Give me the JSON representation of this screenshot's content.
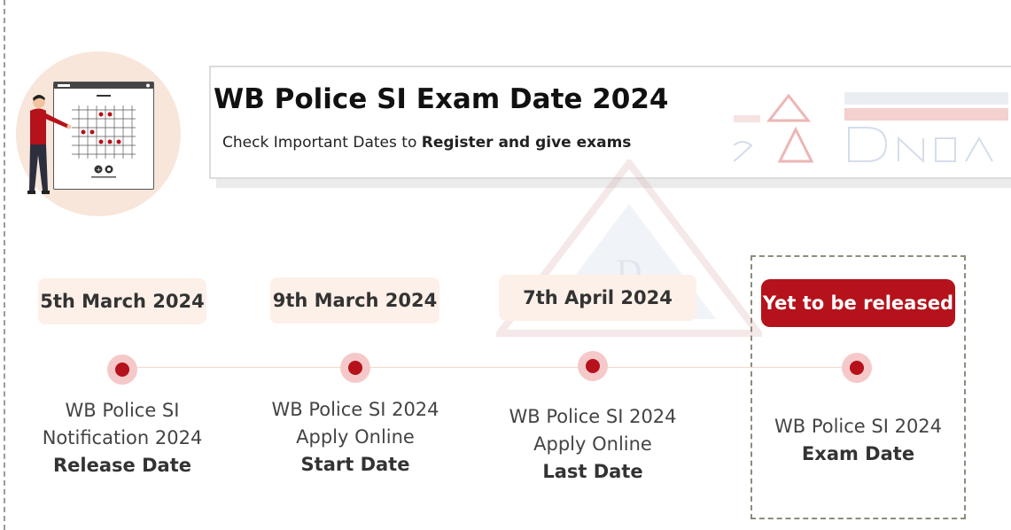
{
  "header": {
    "title": "WB Police SI Exam Date 2024",
    "subtitle_plain": "Check Important Dates to ",
    "subtitle_bold": "Register and give exams"
  },
  "timeline": [
    {
      "date": "5th March 2024",
      "lines": [
        "WB Police SI",
        "Notification 2024"
      ],
      "strong": "Release Date"
    },
    {
      "date": "9th March 2024",
      "lines": [
        "WB Police SI 2024",
        "Apply Online"
      ],
      "strong": "Start Date"
    },
    {
      "date": "7th April 2024",
      "lines": [
        "WB Police SI 2024",
        "Apply Online"
      ],
      "strong": "Last Date"
    },
    {
      "date": "Yet to be released",
      "lines": [
        "WB Police SI 2024"
      ],
      "strong": "Exam Date"
    }
  ],
  "colors": {
    "accent": "#b5121b",
    "pill_bg": "#fdf0e8",
    "dot_halo": "#f5c9c9",
    "illustration_bg": "#f8e6da"
  },
  "icons": [
    "presenter-illustration",
    "zoom-in-icon",
    "zoom-out-icon"
  ]
}
